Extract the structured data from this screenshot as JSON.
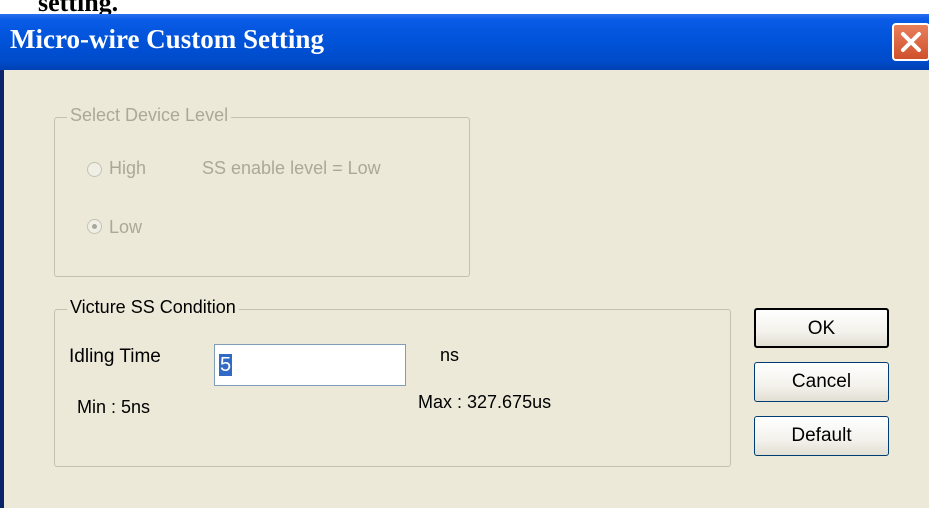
{
  "document_fragment": "setting.",
  "window": {
    "title": "Micro-wire Custom Setting"
  },
  "device_level_group": {
    "title": "Select Device Level",
    "options": [
      {
        "label": "High",
        "selected": false
      },
      {
        "label": "Low",
        "selected": true
      }
    ],
    "ss_enable_text": "SS enable level  = Low",
    "enabled": false
  },
  "ss_condition_group": {
    "title": "Victure SS Condition",
    "idling_time_label": "Idling Time",
    "idling_time_value": "5",
    "unit": "ns",
    "min_text": "Min : 5ns",
    "max_text": "Max : 327.675us"
  },
  "buttons": {
    "ok": "OK",
    "cancel": "Cancel",
    "default": "Default"
  },
  "icons": {
    "close": "close-icon"
  }
}
